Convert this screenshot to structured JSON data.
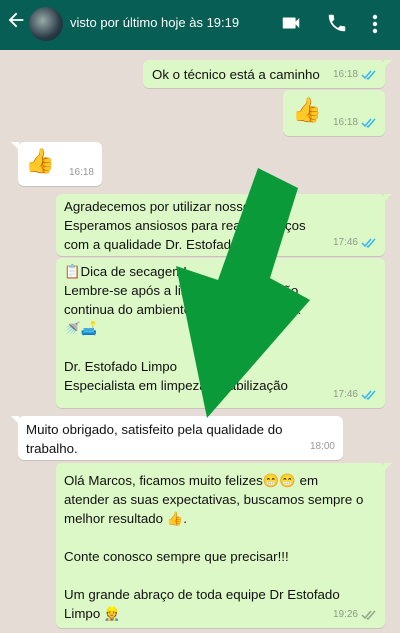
{
  "header": {
    "status": "visto por último hoje às 19:19",
    "icons": [
      "back-arrow-icon",
      "avatar",
      "video-call-icon",
      "phone-icon",
      "more-vert-icon"
    ]
  },
  "messages": [
    {
      "dir": "out",
      "text": "Ok o técnico está a caminho",
      "time": "16:18",
      "read": true
    },
    {
      "dir": "out",
      "text": "👍",
      "time": "16:18",
      "read": true
    },
    {
      "dir": "in",
      "text": "👍",
      "time": "16:18"
    },
    {
      "dir": "out",
      "text": "Agradecemos por utilizar nosso\nEsperamos ansiosos para realiz          serviços\ncom a qualidade Dr. Estofado",
      "time": "17:46",
      "read": true
    },
    {
      "dir": "out",
      "text": "📋Dica de secagem!\nLembre-se após a limpeza          io ventilação\ncontinua do ambiente par          a mais rápida!\n🚿🛋️\n\nDr. Estofado Limpo\nEspecialista em limpeza          meabilização",
      "time": "17:46",
      "read": true
    },
    {
      "dir": "in",
      "text": "Muito obrigado, satisfeito pela qualidade do\ntrabalho.",
      "time": "18:00"
    },
    {
      "dir": "out",
      "text": "Olá Marcos, ficamos muito felizes😁😁 em\natender as suas expectativas, buscamos sempre o\nmelhor resultado 👍.\n\nConte conosco sempre que precisar!!!\n\nUm grande abraço de toda equipe Dr Estofado\nLimpo 👷",
      "time": "19:26",
      "read": false
    }
  ],
  "colors": {
    "header": "#075e54",
    "chat_bg": "#e5ddd5",
    "outgoing": "#dcf8c6",
    "incoming": "#ffffff",
    "read_tick": "#34b7f1",
    "unread_tick": "#92a58c",
    "overlay_arrow": "#0b9a3a"
  }
}
